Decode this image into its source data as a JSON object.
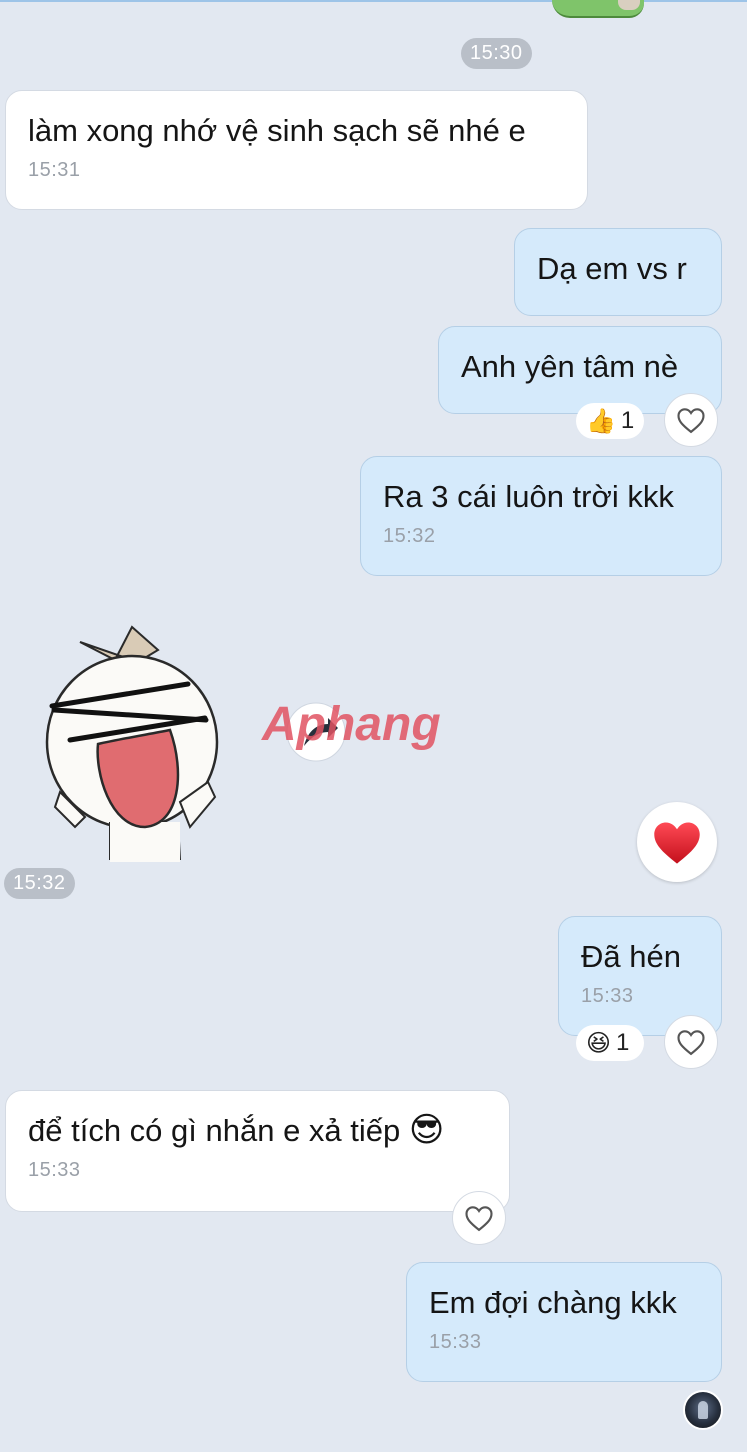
{
  "chat": {
    "time_separator_1": "15:30",
    "messages": [
      {
        "text": "làm xong nhớ vệ sinh sạch sẽ nhé e",
        "time": "15:31",
        "from": "them"
      },
      {
        "text": "Dạ em vs r",
        "time": "",
        "from": "me"
      },
      {
        "text": "Anh yên tâm nè",
        "time": "",
        "from": "me",
        "reaction": {
          "emoji": "👍",
          "count": "1"
        }
      },
      {
        "text": "Ra 3 cái luôn trời kkk",
        "time": "15:32",
        "from": "me"
      },
      {
        "text": "Đã hén",
        "time": "15:33",
        "from": "me",
        "reaction": {
          "emoji": "😆",
          "count": "1"
        }
      },
      {
        "text": "để tích có gì nhắn e xả tiếp",
        "emoji": "😎",
        "time": "15:33",
        "from": "them"
      },
      {
        "text": "Em đợi chàng kkk",
        "time": "15:33",
        "from": "me"
      }
    ],
    "sticker": {
      "time": "15:32",
      "reaction_icon": "heart-icon"
    },
    "watermark": "Aphang"
  },
  "colors": {
    "background": "#e2e8f1",
    "outgoing_bubble": "#d5eafb",
    "incoming_bubble": "#ffffff",
    "heart": "#e0192b"
  }
}
